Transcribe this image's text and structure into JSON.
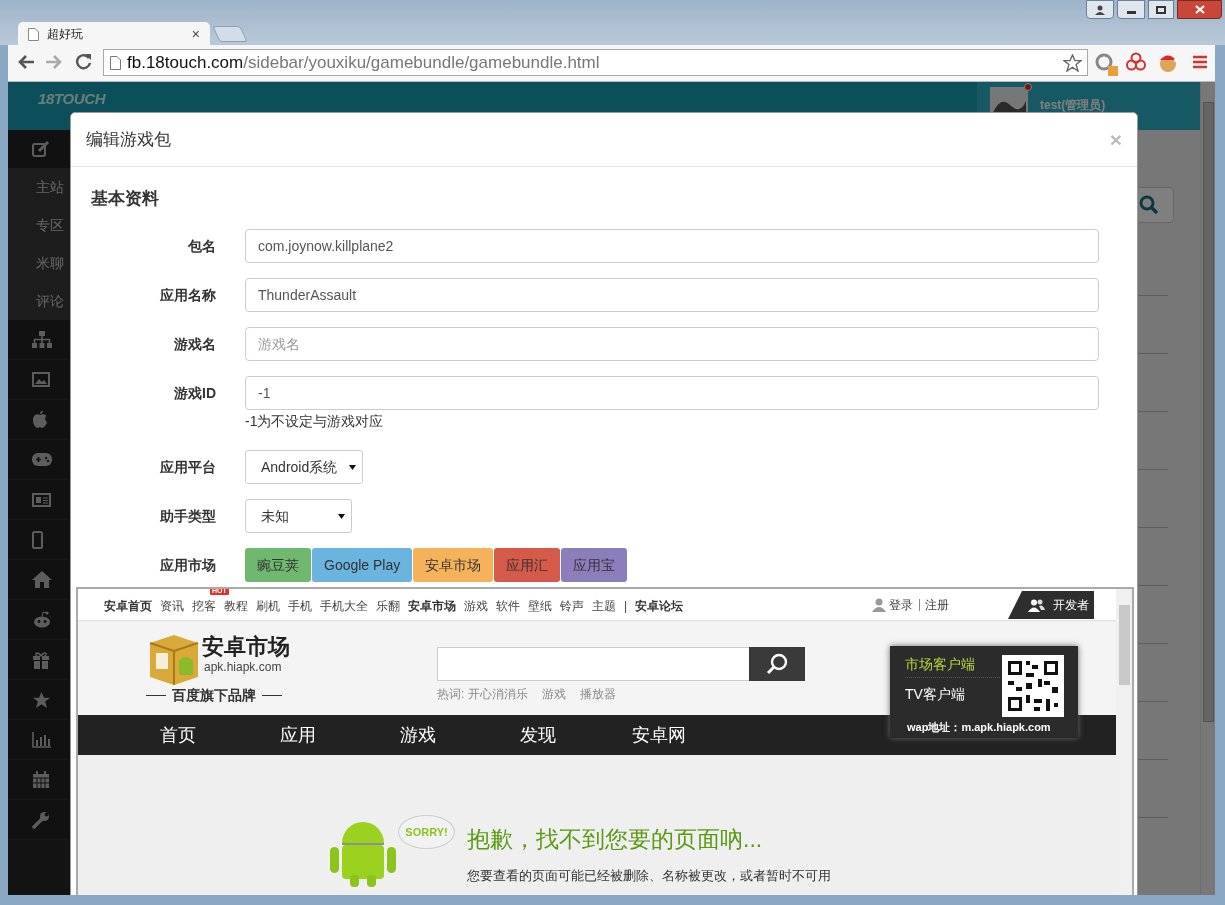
{
  "browser": {
    "tabs": [
      {
        "title": "超好玩",
        "selected": true
      }
    ],
    "close_tab": "×",
    "url_host": "fb.18touch.com",
    "url_path": "/sidebar/youxiku/gamebundle/gamebundle.html"
  },
  "header": {
    "logo": "18TOUCH",
    "user": "test(管理员)"
  },
  "sidebar": {
    "expanded": true,
    "children": [
      "主站",
      "专区",
      "米聊",
      "评论"
    ]
  },
  "modal": {
    "title": "编辑游戏包",
    "close": "×",
    "section": "基本资料",
    "fields": [
      {
        "kind": "input",
        "label": "包名",
        "value": "com.joynow.killplane2"
      },
      {
        "kind": "input",
        "label": "应用名称",
        "value": "ThunderAssault"
      },
      {
        "kind": "input",
        "label": "游戏名",
        "placeholder": "游戏名"
      },
      {
        "kind": "input",
        "label": "游戏ID",
        "value": "-1",
        "help": "-1为不设定与游戏对应"
      },
      {
        "kind": "select",
        "label": "应用平台",
        "value": "Android系统"
      },
      {
        "kind": "select",
        "label": "助手类型",
        "value": "未知"
      },
      {
        "kind": "buttons",
        "label": "应用市场",
        "buttons": [
          {
            "label": "豌豆荚",
            "color": "#70b86f"
          },
          {
            "label": "Google Play",
            "color": "#6bb4e0"
          },
          {
            "label": "安卓市场",
            "color": "#f6b25a"
          },
          {
            "label": "应用汇",
            "color": "#d65a4a"
          },
          {
            "label": "应用宝",
            "color": "#8c7dbd"
          }
        ]
      }
    ]
  },
  "embedded_page": {
    "top_links": [
      {
        "text": "安卓首页",
        "bold": true
      },
      {
        "text": "资讯",
        "bold": false
      },
      {
        "text": "挖客",
        "bold": false,
        "badge": "HOT"
      },
      {
        "text": "教程",
        "bold": false
      },
      {
        "text": "刷机",
        "bold": false
      },
      {
        "text": "手机",
        "bold": false
      },
      {
        "text": "手机大全",
        "bold": false
      },
      {
        "text": "乐翻",
        "bold": false
      },
      {
        "text": "安卓市场",
        "bold": true
      },
      {
        "text": "游戏",
        "bold": false
      },
      {
        "text": "软件",
        "bold": false
      },
      {
        "text": "壁纸",
        "bold": false
      },
      {
        "text": "铃声",
        "bold": false
      },
      {
        "text": "主题",
        "bold": false
      },
      {
        "text": "|",
        "bold": false
      },
      {
        "text": "安卓论坛",
        "bold": true
      }
    ],
    "login": "登录",
    "register": "注册",
    "developer": "开发者",
    "logo_title": "安卓市场",
    "logo_domain": "apk.hiapk.com",
    "slogan": "百度旗下品牌",
    "hot_label": "热词:",
    "hot_words": [
      "开心消消乐",
      "游戏",
      "播放器"
    ],
    "client_links": [
      {
        "text": "市场客户端",
        "selected": true
      },
      {
        "text": "TV客户端",
        "selected": false
      }
    ],
    "wap": "wap地址：m.apk.hiapk.com",
    "nav": [
      "首页",
      "应用",
      "游戏",
      "发现",
      "安卓网"
    ],
    "sorry_badge": "SORRY!",
    "error_title": "抱歉，找不到您要的页面吶...",
    "error_text": "您要查看的页面可能已经被删除、名称被更改，或者暂时不可用"
  }
}
